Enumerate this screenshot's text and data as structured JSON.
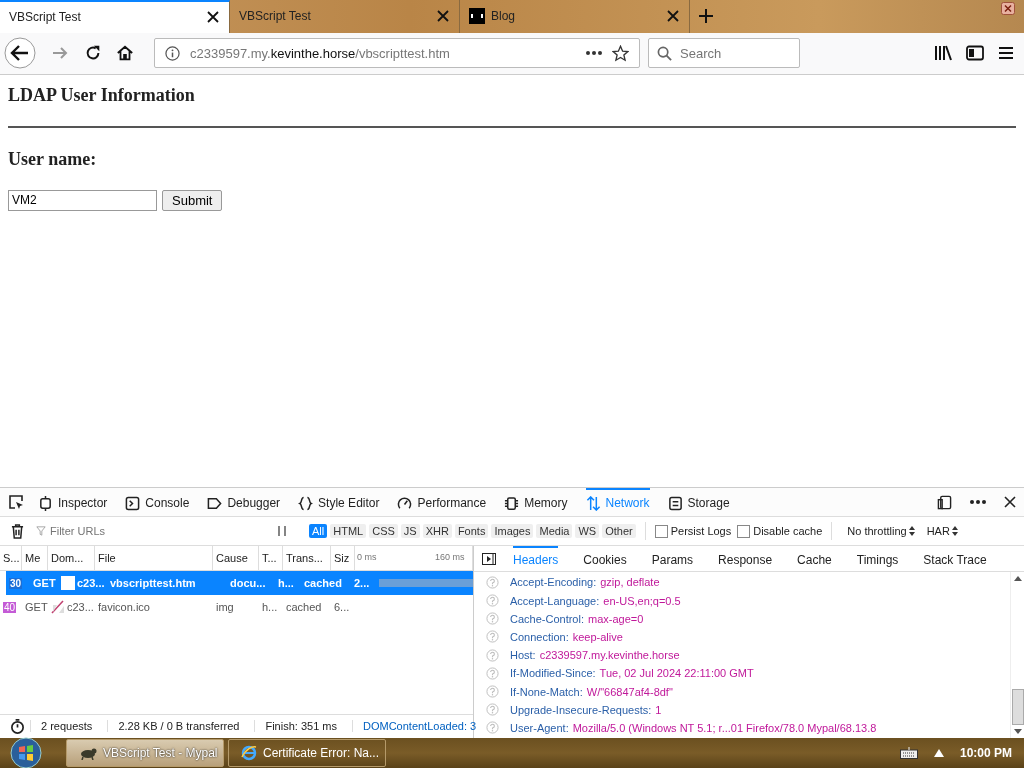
{
  "browser": {
    "tabs": [
      {
        "title": "VBScript Test",
        "selected": true,
        "favicon": false
      },
      {
        "title": "VBScript Test",
        "selected": false,
        "favicon": false
      },
      {
        "title": "Blog",
        "selected": false,
        "favicon": true
      }
    ],
    "url": {
      "prefix": "c2339597.my.",
      "host": "kevinthe.horse",
      "path": "/vbscripttest.htm"
    },
    "search": {
      "placeholder": "Search"
    }
  },
  "page": {
    "heading": "LDAP User Information",
    "label": "User name:",
    "input": {
      "value": "VM2"
    },
    "submit": "Submit"
  },
  "devtools": {
    "tools": [
      {
        "label": "Inspector",
        "kind": "inspector",
        "selected": false
      },
      {
        "label": "Console",
        "kind": "console",
        "selected": false
      },
      {
        "label": "Debugger",
        "kind": "debugger",
        "selected": false
      },
      {
        "label": "Style Editor",
        "kind": "style",
        "selected": false
      },
      {
        "label": "Performance",
        "kind": "performance",
        "selected": false
      },
      {
        "label": "Memory",
        "kind": "memory",
        "selected": false
      },
      {
        "label": "Network",
        "kind": "network",
        "selected": true
      },
      {
        "label": "Storage",
        "kind": "storage",
        "selected": false
      }
    ],
    "filter": {
      "placeholder": "Filter URLs"
    },
    "types": [
      {
        "label": "All",
        "selected": true
      },
      {
        "label": "HTML",
        "selected": false
      },
      {
        "label": "CSS",
        "selected": false
      },
      {
        "label": "JS",
        "selected": false
      },
      {
        "label": "XHR",
        "selected": false
      },
      {
        "label": "Fonts",
        "selected": false
      },
      {
        "label": "Images",
        "selected": false
      },
      {
        "label": "Media",
        "selected": false
      },
      {
        "label": "WS",
        "selected": false
      },
      {
        "label": "Other",
        "selected": false
      }
    ],
    "options": [
      {
        "label": "Persist Logs",
        "checked": false
      },
      {
        "label": "Disable cache",
        "checked": false
      }
    ],
    "throttling": "No throttling",
    "har": "HAR",
    "columns": [
      "S...",
      "Me",
      "Dom...",
      "File",
      "Cause",
      "T...",
      "Trans...",
      "Siz"
    ],
    "ticks": [
      "0 ms",
      "160 ms"
    ],
    "requests": [
      {
        "status": "30",
        "color": "#1b6fd8",
        "method": "GET",
        "domain": "c23...",
        "file": "vbscripttest.htm",
        "cause": "docu...",
        "type": "h...",
        "transferred": "cached",
        "size": "2...",
        "selected": true,
        "kind": "document"
      },
      {
        "status": "40",
        "color": "#c45bd6",
        "method": "GET",
        "domain": "c23...",
        "file": "favicon.ico",
        "cause": "img",
        "type": "h...",
        "transferred": "cached",
        "size": "6...",
        "selected": false,
        "kind": "image"
      }
    ],
    "detail_tabs": [
      {
        "label": "Headers",
        "selected": true
      },
      {
        "label": "Cookies",
        "selected": false
      },
      {
        "label": "Params",
        "selected": false
      },
      {
        "label": "Response",
        "selected": false
      },
      {
        "label": "Cache",
        "selected": false
      },
      {
        "label": "Timings",
        "selected": false
      },
      {
        "label": "Stack Trace",
        "selected": false
      }
    ],
    "headers": [
      {
        "name": "Accept-Encoding:",
        "value": "gzip, deflate"
      },
      {
        "name": "Accept-Language:",
        "value": "en-US,en;q=0.5"
      },
      {
        "name": "Cache-Control:",
        "value": "max-age=0"
      },
      {
        "name": "Connection:",
        "value": "keep-alive"
      },
      {
        "name": "Host:",
        "value": "c2339597.my.kevinthe.horse"
      },
      {
        "name": "If-Modified-Since:",
        "value": "Tue, 02 Jul 2024 22:11:00 GMT"
      },
      {
        "name": "If-None-Match:",
        "value": "W/\"66847af4-8df\""
      },
      {
        "name": "Upgrade-Insecure-Requests:",
        "value": "1"
      },
      {
        "name": "User-Agent:",
        "value": "Mozilla/5.0 (Windows NT 5.1; r...01 Firefox/78.0 Mypal/68.13.8"
      }
    ],
    "summary": [
      {
        "text": "2 requests",
        "kind": "plain"
      },
      {
        "text": "2.28 KB / 0 B transferred",
        "kind": "plain"
      },
      {
        "text": "Finish: 351 ms",
        "kind": "plain"
      },
      {
        "text": "DOMContentLoaded: 3",
        "kind": "link"
      }
    ]
  },
  "taskbar": {
    "items": [
      {
        "title": "VBScript Test - Mypal",
        "selected": true,
        "kind": "browser"
      },
      {
        "title": "Certificate Error: Na...",
        "selected": false,
        "kind": "ie"
      }
    ],
    "clock": "10:00 PM"
  }
}
